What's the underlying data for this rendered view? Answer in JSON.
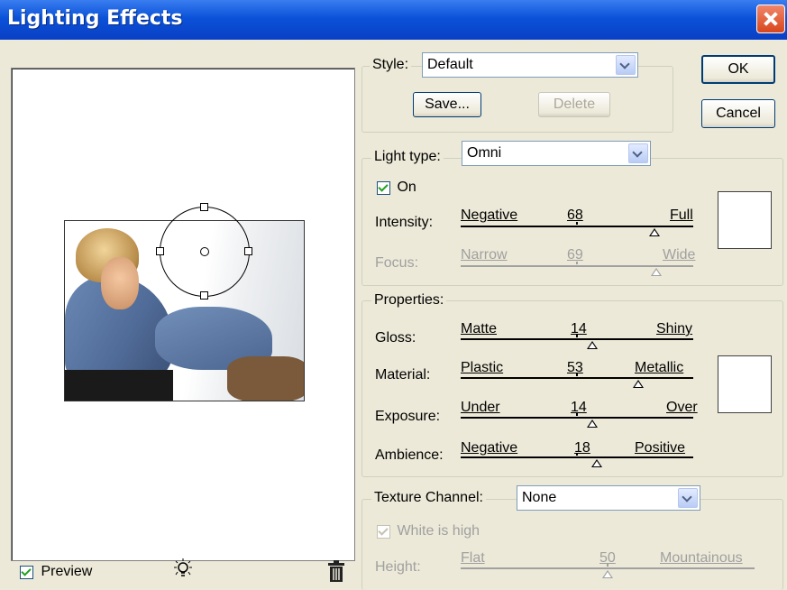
{
  "window": {
    "title": "Lighting Effects"
  },
  "preview": {
    "checkbox_label": "Preview",
    "checked": true,
    "bulb_icon": "light-bulb-icon",
    "trash_icon": "trash-icon"
  },
  "style": {
    "label": "Style:",
    "value": "Default",
    "save": "Save...",
    "delete": "Delete"
  },
  "buttons": {
    "ok": "OK",
    "cancel": "Cancel"
  },
  "light": {
    "type_label": "Light type:",
    "type_value": "Omni",
    "on_label": "On",
    "on_checked": true,
    "intensity": {
      "label": "Intensity:",
      "min": "Negative",
      "value": "68",
      "max": "Full"
    },
    "focus": {
      "label": "Focus:",
      "min": "Narrow",
      "value": "69",
      "max": "Wide"
    }
  },
  "properties": {
    "label": "Properties:",
    "gloss": {
      "label": "Gloss:",
      "min": "Matte",
      "value": "14",
      "max": "Shiny"
    },
    "material": {
      "label": "Material:",
      "min": "Plastic",
      "value": "53",
      "max": "Metallic"
    },
    "exposure": {
      "label": "Exposure:",
      "min": "Under",
      "value": "14",
      "max": "Over"
    },
    "ambience": {
      "label": "Ambience:",
      "min": "Negative",
      "value": "18",
      "max": "Positive"
    }
  },
  "texture": {
    "label": "Texture Channel:",
    "value": "None",
    "white_is_high": "White is high",
    "height": {
      "label": "Height:",
      "min": "Flat",
      "value": "50",
      "max": "Mountainous"
    }
  }
}
